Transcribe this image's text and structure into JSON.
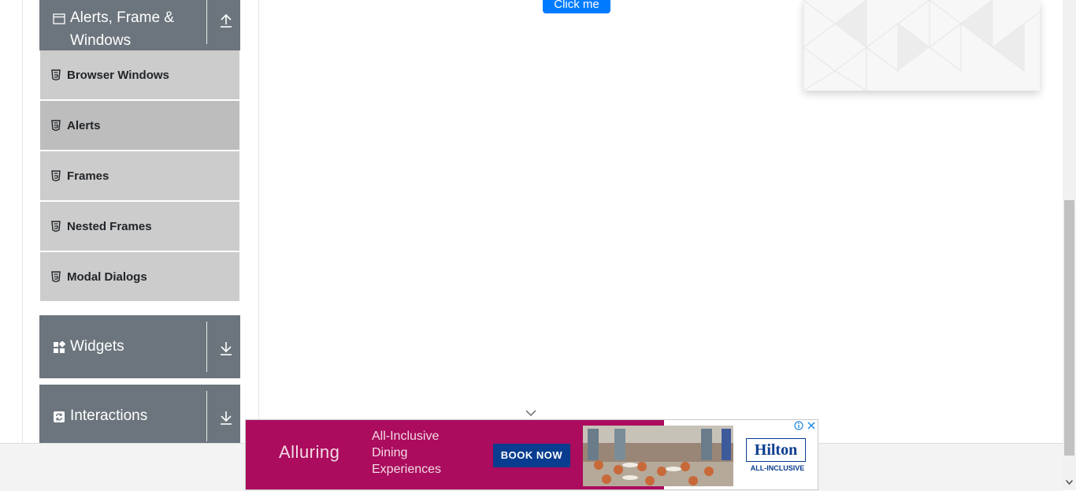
{
  "sidebar": {
    "groups": {
      "alerts": {
        "title_line1": "Alerts, Frame &",
        "title_line2": "Windows",
        "icon": "window-icon",
        "arrow": "arrow-up-icon"
      },
      "widgets": {
        "title": "Widgets",
        "icon": "widgets-grid-icon",
        "arrow": "arrow-down-icon"
      },
      "interactions": {
        "title": "Interactions",
        "icon": "interactions-icon",
        "arrow": "arrow-down-icon"
      }
    },
    "items": [
      {
        "label": "Browser Windows",
        "icon": "html5-icon",
        "active": false
      },
      {
        "label": "Alerts",
        "icon": "html5-icon",
        "active": true
      },
      {
        "label": "Frames",
        "icon": "html5-icon",
        "active": false
      },
      {
        "label": "Nested Frames",
        "icon": "html5-icon",
        "active": false
      },
      {
        "label": "Modal Dialogs",
        "icon": "html5-icon",
        "active": false
      }
    ]
  },
  "main": {
    "click_button_label": "Click me"
  },
  "ad": {
    "brand": "Alluring",
    "copy_line1": "All-Inclusive",
    "copy_line2": "Dining",
    "copy_line3": "Experiences",
    "button_label": "BOOK NOW",
    "logo": "Hilton",
    "logo_sub": "ALL-INCLUSIVE",
    "colors": {
      "background": "#ab0c5d",
      "button": "#0a3d8f"
    }
  },
  "colors": {
    "sidebar_header": "#6c757d",
    "menu_item": "#cccccc",
    "menu_item_active": "#bdbdbd",
    "primary_button": "#007bff"
  }
}
